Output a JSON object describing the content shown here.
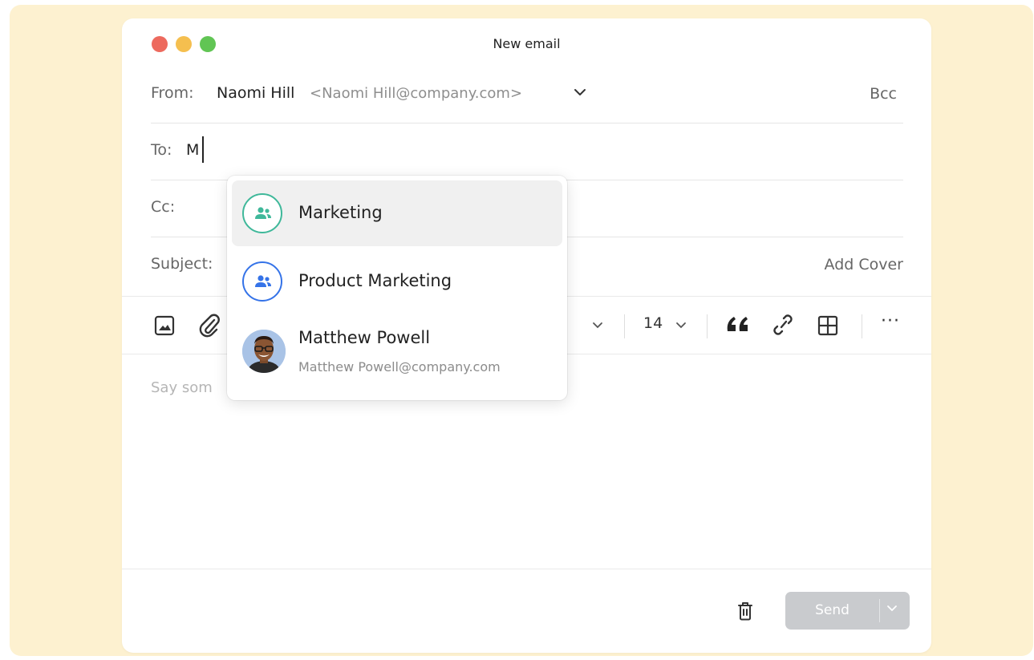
{
  "window": {
    "title": "New email"
  },
  "from": {
    "label": "From:",
    "name": "Naomi Hill",
    "email": "<Naomi Hill@company.com>",
    "bcc": "Bcc"
  },
  "to": {
    "label": "To:",
    "value": "M"
  },
  "cc": {
    "label": "Cc:"
  },
  "subject": {
    "label": "Subject:",
    "add_cover": "Add Cover"
  },
  "toolbar": {
    "font_size": "14",
    "more": "···"
  },
  "body": {
    "placeholder_visible": "Say som"
  },
  "footer": {
    "send_label": "Send"
  },
  "suggestions": [
    {
      "name": "Marketing",
      "type": "group",
      "icon_color": "#3fb89a",
      "highlighted": true
    },
    {
      "name": "Product Marketing",
      "type": "group",
      "icon_color": "#3573e8",
      "highlighted": false
    },
    {
      "name": "Matthew Powell",
      "email": "Matthew Powell@company.com",
      "type": "person"
    }
  ],
  "colors": {
    "backdrop": "#fdf1d0",
    "send_disabled": "#c9cbce",
    "dot_red": "#ed6a5e",
    "dot_yellow": "#f5bf4f",
    "dot_green": "#61c554"
  }
}
